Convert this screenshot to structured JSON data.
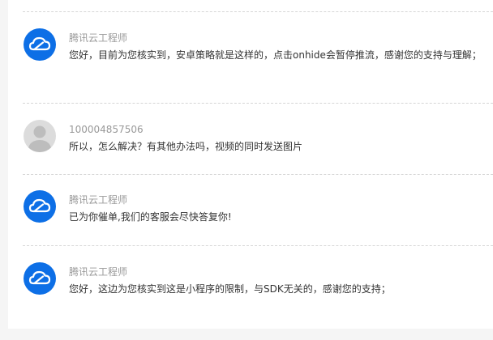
{
  "comments": [
    {
      "author": "腾讯云工程师",
      "avatar_icon": "tencent-cloud-logo-icon",
      "text": "您好，目前为您核实到，安卓策略就是这样的，点击onhide会暂停推流，感谢您的支持与理解；"
    },
    {
      "author": "100004857506",
      "avatar_icon": "default-user-avatar-icon",
      "text": "所以，怎么解决？有其他办法吗，视频的同时发送图片"
    },
    {
      "author": "腾讯云工程师",
      "avatar_icon": "tencent-cloud-logo-icon",
      "text": "已为你催单,我们的客服会尽快答复你!"
    },
    {
      "author": "腾讯云工程师",
      "avatar_icon": "tencent-cloud-logo-icon",
      "text": "您好，这边为您核实到这是小程序的限制，与SDK无关的，感谢您的支持；"
    }
  ],
  "colors": {
    "brand_blue": "#0d6fe6",
    "author_gray": "#999999",
    "text_dark": "#333333",
    "divider": "#d6d6d6"
  }
}
